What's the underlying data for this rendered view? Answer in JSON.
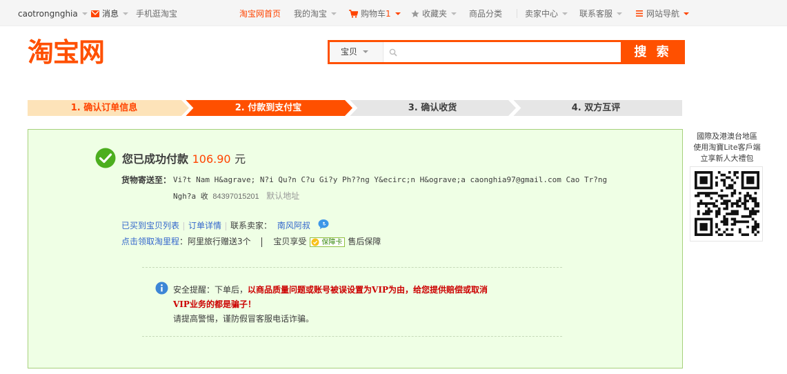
{
  "topbar": {
    "username": "caotrongnghia",
    "messages": "消息",
    "mobile": "手机逛淘宝",
    "home": "淘宝网首页",
    "my_taobao": "我的淘宝",
    "cart": "购物车",
    "cart_count": "1",
    "favorites": "收藏夹",
    "categories": "商品分类",
    "seller_center": "卖家中心",
    "support": "联系客服",
    "site_nav": "网站导航"
  },
  "header": {
    "logo_text": "淘宝网",
    "search_category": "宝贝",
    "search_value": "",
    "search_button": "搜 索"
  },
  "steps": [
    {
      "label": "1. 确认订单信息",
      "state": "done"
    },
    {
      "label": "2. 付款到支付宝",
      "state": "current"
    },
    {
      "label": "3. 确认收货",
      "state": "todo"
    },
    {
      "label": "4. 双方互评",
      "state": "todo"
    }
  ],
  "result": {
    "title": "您已成功付款",
    "amount": "106.90",
    "currency": "元",
    "ship_label": "货物寄送至：",
    "address_line1": "Vi?t Nam H&agrave; N?i Qu?n C?u Gi?y Ph??ng Y&ecirc;n H&ograve;a caonghia97@gmail.com Cao Tr?ng",
    "address_line2": "Ngh?a 收",
    "phone": "84397015201",
    "default_addr": "默认地址",
    "link_bought": "已买到宝贝列表",
    "link_order": "订单详情",
    "contact_label": "联系卖家：",
    "seller": "南风阿叔",
    "link_mileage": "点击领取淘里程",
    "mileage_text": "：阿里旅行赠送3个",
    "guarantee_text": "宝贝享受",
    "guarantee_badge": "保障卡",
    "after_sale": "售后保障",
    "warn_prefix": "安全提醒：下单后，",
    "warn_red1": "以商品质量问题或账号被误设置为VIP为由，给您提供赔偿或取消",
    "warn_red2": "VIP业务的都是骗子！",
    "warn_tail": "请提高警惕，谨防假冒客服电话诈骗。"
  },
  "promo": {
    "line1": "國際及港澳台地區",
    "line2": "使用淘寶Lite客戶端",
    "line3": "立享新人大禮包"
  },
  "colors": {
    "brand_orange": "#ff5000",
    "link_blue": "#3366cc",
    "success_green": "#4cae1f",
    "box_bg": "#efffe5"
  }
}
